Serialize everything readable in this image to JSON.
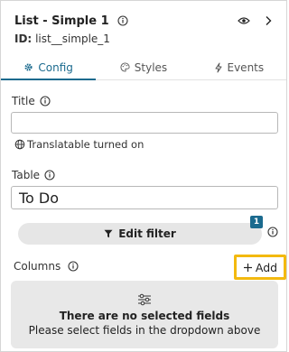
{
  "header": {
    "title": "List - Simple 1",
    "id_label": "ID:",
    "id_value": "list__simple_1"
  },
  "tabs": [
    {
      "label": "Config",
      "icon": "gear-icon",
      "active": true
    },
    {
      "label": "Styles",
      "icon": "palette-icon",
      "active": false
    },
    {
      "label": "Events",
      "icon": "lightning-icon",
      "active": false
    }
  ],
  "fields": {
    "title_label": "Title",
    "title_value": "",
    "translatable_text": "Translatable turned on",
    "table_label": "Table",
    "table_value": "To Do"
  },
  "filter": {
    "button_label": "Edit filter",
    "badge_count": "1"
  },
  "columns": {
    "label": "Columns",
    "add_label": "Add",
    "empty_title": "There are no selected fields",
    "empty_subtitle": "Please select fields in the dropdown above"
  },
  "colors": {
    "accent": "#1b6a8e",
    "highlight": "#f3b90f"
  }
}
